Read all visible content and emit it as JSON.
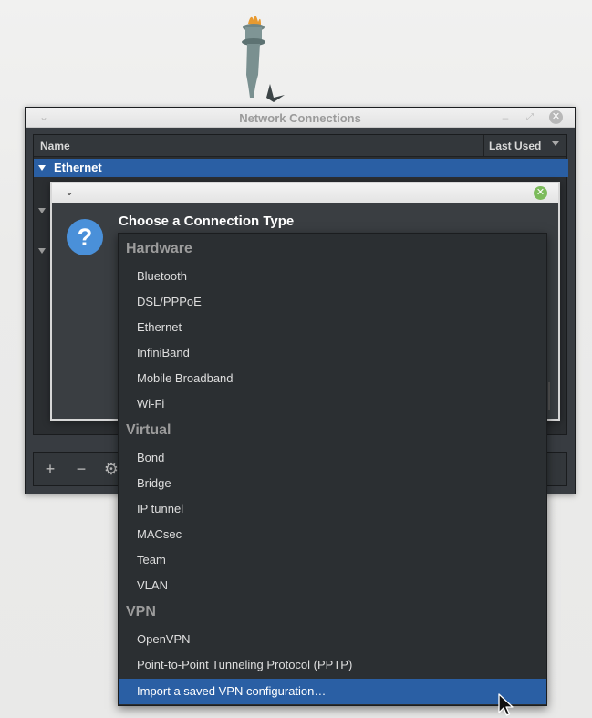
{
  "window": {
    "title": "Network Connections",
    "columns": {
      "name": "Name",
      "last_used": "Last Used"
    },
    "group": "Ethernet",
    "toolbar": {
      "add": "+",
      "remove": "−"
    }
  },
  "dialog": {
    "heading": "Choose a Connection Type"
  },
  "dropdown": {
    "sections": [
      {
        "label": "Hardware",
        "items": [
          "Bluetooth",
          "DSL/PPPoE",
          "Ethernet",
          "InfiniBand",
          "Mobile Broadband",
          "Wi-Fi"
        ]
      },
      {
        "label": "Virtual",
        "items": [
          "Bond",
          "Bridge",
          "IP tunnel",
          "MACsec",
          "Team",
          "VLAN"
        ]
      },
      {
        "label": "VPN",
        "items": [
          "OpenVPN",
          "Point-to-Point Tunneling Protocol (PPTP)",
          "Import a saved VPN configuration…"
        ]
      }
    ],
    "selected_item": "Import a saved VPN configuration…"
  },
  "colors": {
    "selection": "#2a5fa4",
    "dialog_close": "#7cbb5b",
    "question_icon": "#4a90d9"
  },
  "icons": [
    "window-menu-icon",
    "minimize-icon",
    "maximize-icon",
    "close-icon",
    "question-icon",
    "gear-icon",
    "cursor-icon"
  ]
}
